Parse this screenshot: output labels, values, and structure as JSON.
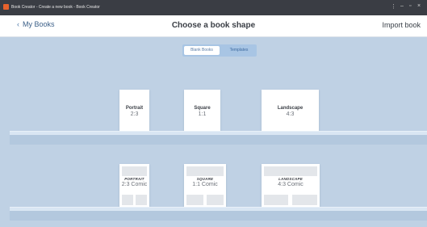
{
  "window": {
    "title": "Book Creator - Create a new book - Book Creator",
    "controls": {
      "more": "⋮",
      "minimize": "–",
      "maximize": "▫",
      "close": "×"
    }
  },
  "header": {
    "back_label": "My Books",
    "back_icon": "chevron-left-icon",
    "title": "Choose a book shape",
    "import_label": "Import book"
  },
  "toggle": {
    "options": [
      "Blank Books",
      "Templates"
    ],
    "selected": "Blank Books"
  },
  "blank_books": [
    {
      "name": "Portrait",
      "ratio": "2:3"
    },
    {
      "name": "Square",
      "ratio": "1:1"
    },
    {
      "name": "Landscape",
      "ratio": "4:3"
    }
  ],
  "comic_books": [
    {
      "name": "PORTRAIT",
      "ratio": "2:3 Comic"
    },
    {
      "name": "SQUARE",
      "ratio": "1:1 Comic"
    },
    {
      "name": "LANDSCAPE",
      "ratio": "4:3 Comic"
    }
  ],
  "colors": {
    "background": "#bfd1e4",
    "titlebar": "#3a3d44",
    "accent": "#a8c5e4",
    "brand_icon": "#e8622c"
  }
}
